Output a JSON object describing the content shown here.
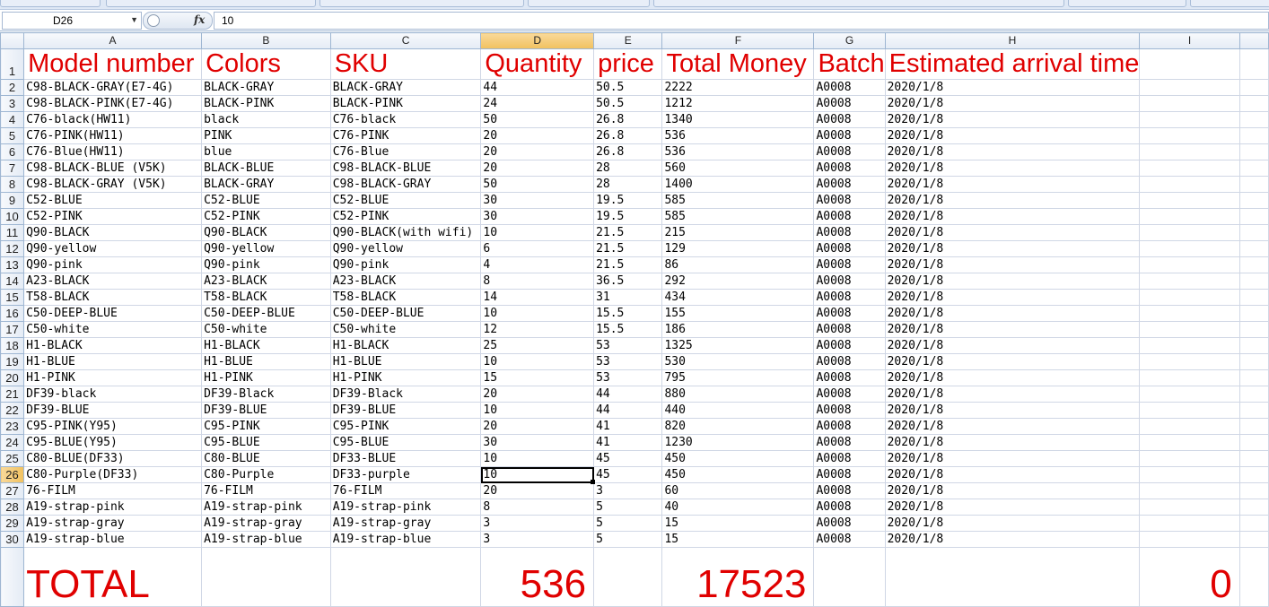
{
  "name_box": "D26",
  "formula_value": "10",
  "columns": [
    "",
    "A",
    "B",
    "C",
    "D",
    "E",
    "F",
    "G",
    "H",
    "I",
    ""
  ],
  "selected_column": "D",
  "selected_row": "26",
  "header_row": {
    "row": "1",
    "cells": [
      "Model number",
      "Colors",
      "SKU",
      "Quantity",
      "price",
      "Total Money",
      "Batch",
      "Estimated arrival time",
      "",
      ""
    ]
  },
  "rows": [
    {
      "row": "2",
      "cells": [
        "C98-BLACK-GRAY(E7-4G)",
        "BLACK-GRAY",
        "BLACK-GRAY",
        "44",
        "50.5",
        "2222",
        "A0008",
        "2020/1/8",
        "",
        ""
      ]
    },
    {
      "row": "3",
      "cells": [
        "C98-BLACK-PINK(E7-4G)",
        "BLACK-PINK",
        "BLACK-PINK",
        "24",
        "50.5",
        "1212",
        "A0008",
        "2020/1/8",
        "",
        ""
      ]
    },
    {
      "row": "4",
      "cells": [
        "C76-black(HW11)",
        "black",
        "C76-black",
        "50",
        "26.8",
        "1340",
        "A0008",
        "2020/1/8",
        "",
        ""
      ]
    },
    {
      "row": "5",
      "cells": [
        "C76-PINK(HW11)",
        "PINK",
        "C76-PINK",
        "20",
        "26.8",
        "536",
        "A0008",
        "2020/1/8",
        "",
        ""
      ]
    },
    {
      "row": "6",
      "cells": [
        "C76-Blue(HW11)",
        "blue",
        "C76-Blue",
        "20",
        "26.8",
        "536",
        "A0008",
        "2020/1/8",
        "",
        ""
      ]
    },
    {
      "row": "7",
      "cells": [
        "C98-BLACK-BLUE (V5K)",
        "BLACK-BLUE",
        "C98-BLACK-BLUE",
        "20",
        "28",
        "560",
        "A0008",
        "2020/1/8",
        "",
        ""
      ]
    },
    {
      "row": "8",
      "cells": [
        "C98-BLACK-GRAY (V5K)",
        "BLACK-GRAY",
        "C98-BLACK-GRAY",
        "50",
        "28",
        "1400",
        "A0008",
        "2020/1/8",
        "",
        ""
      ]
    },
    {
      "row": "9",
      "cells": [
        "C52-BLUE",
        "C52-BLUE",
        "C52-BLUE",
        "30",
        "19.5",
        "585",
        "A0008",
        "2020/1/8",
        "",
        ""
      ]
    },
    {
      "row": "10",
      "cells": [
        "C52-PINK",
        "C52-PINK",
        "C52-PINK",
        "30",
        "19.5",
        "585",
        "A0008",
        "2020/1/8",
        "",
        ""
      ]
    },
    {
      "row": "11",
      "cells": [
        "Q90-BLACK",
        "Q90-BLACK",
        "Q90-BLACK(with wifi)",
        "10",
        "21.5",
        "215",
        "A0008",
        "2020/1/8",
        "",
        ""
      ]
    },
    {
      "row": "12",
      "cells": [
        "Q90-yellow",
        "Q90-yellow",
        "Q90-yellow",
        "6",
        "21.5",
        "129",
        "A0008",
        "2020/1/8",
        "",
        ""
      ]
    },
    {
      "row": "13",
      "cells": [
        "Q90-pink",
        "Q90-pink",
        "Q90-pink",
        "4",
        "21.5",
        "86",
        "A0008",
        "2020/1/8",
        "",
        ""
      ]
    },
    {
      "row": "14",
      "cells": [
        "A23-BLACK",
        "A23-BLACK",
        "A23-BLACK",
        "8",
        "36.5",
        "292",
        "A0008",
        "2020/1/8",
        "",
        ""
      ]
    },
    {
      "row": "15",
      "cells": [
        "T58-BLACK",
        "T58-BLACK",
        "T58-BLACK",
        "14",
        "31",
        "434",
        "A0008",
        "2020/1/8",
        "",
        ""
      ]
    },
    {
      "row": "16",
      "cells": [
        "C50-DEEP-BLUE",
        "C50-DEEP-BLUE",
        "C50-DEEP-BLUE",
        "10",
        "15.5",
        "155",
        "A0008",
        "2020/1/8",
        "",
        ""
      ]
    },
    {
      "row": "17",
      "cells": [
        "C50-white",
        "C50-white",
        "C50-white",
        "12",
        "15.5",
        "186",
        "A0008",
        "2020/1/8",
        "",
        ""
      ]
    },
    {
      "row": "18",
      "cells": [
        "H1-BLACK",
        "H1-BLACK",
        "H1-BLACK",
        "25",
        "53",
        "1325",
        "A0008",
        "2020/1/8",
        "",
        ""
      ]
    },
    {
      "row": "19",
      "cells": [
        "H1-BLUE",
        "H1-BLUE",
        "H1-BLUE",
        "10",
        "53",
        "530",
        "A0008",
        "2020/1/8",
        "",
        ""
      ]
    },
    {
      "row": "20",
      "cells": [
        "H1-PINK",
        "H1-PINK",
        "H1-PINK",
        "15",
        "53",
        "795",
        "A0008",
        "2020/1/8",
        "",
        ""
      ]
    },
    {
      "row": "21",
      "cells": [
        "DF39-black",
        "DF39-Black",
        "DF39-Black",
        "20",
        "44",
        "880",
        "A0008",
        "2020/1/8",
        "",
        ""
      ]
    },
    {
      "row": "22",
      "cells": [
        "DF39-BLUE",
        "DF39-BLUE",
        "DF39-BLUE",
        "10",
        "44",
        "440",
        "A0008",
        "2020/1/8",
        "",
        ""
      ]
    },
    {
      "row": "23",
      "cells": [
        "C95-PINK(Y95)",
        "C95-PINK",
        "C95-PINK",
        "20",
        "41",
        "820",
        "A0008",
        "2020/1/8",
        "",
        ""
      ]
    },
    {
      "row": "24",
      "cells": [
        "C95-BLUE(Y95)",
        "C95-BLUE",
        "C95-BLUE",
        "30",
        "41",
        "1230",
        "A0008",
        "2020/1/8",
        "",
        ""
      ]
    },
    {
      "row": "25",
      "cells": [
        "C80-BLUE(DF33)",
        "C80-BLUE",
        "DF33-BLUE",
        "10",
        "45",
        "450",
        "A0008",
        "2020/1/8",
        "",
        ""
      ]
    },
    {
      "row": "26",
      "cells": [
        "C80-Purple(DF33)",
        "C80-Purple",
        "DF33-purple",
        "10",
        "45",
        "450",
        "A0008",
        "2020/1/8",
        "",
        ""
      ]
    },
    {
      "row": "27",
      "cells": [
        "76-FILM",
        "76-FILM",
        "76-FILM",
        "20",
        "3",
        "60",
        "A0008",
        "2020/1/8",
        "",
        ""
      ]
    },
    {
      "row": "28",
      "cells": [
        "A19-strap-pink",
        "A19-strap-pink",
        "A19-strap-pink",
        "8",
        "5",
        "40",
        "A0008",
        "2020/1/8",
        "",
        ""
      ]
    },
    {
      "row": "29",
      "cells": [
        "A19-strap-gray",
        "A19-strap-gray",
        "A19-strap-gray",
        "3",
        "5",
        "15",
        "A0008",
        "2020/1/8",
        "",
        ""
      ]
    },
    {
      "row": "30",
      "cells": [
        "A19-strap-blue",
        "A19-strap-blue",
        "A19-strap-blue",
        "3",
        "5",
        "15",
        "A0008",
        "2020/1/8",
        "",
        ""
      ]
    }
  ],
  "total_row": {
    "cells": [
      "TOTAL",
      "",
      "",
      "536",
      "",
      "17523",
      "",
      "",
      "0",
      ""
    ]
  },
  "colors": {
    "header_text": "#e00000",
    "selection_highlight": "#f1c15f",
    "grid_line": "#d0d7e5"
  }
}
